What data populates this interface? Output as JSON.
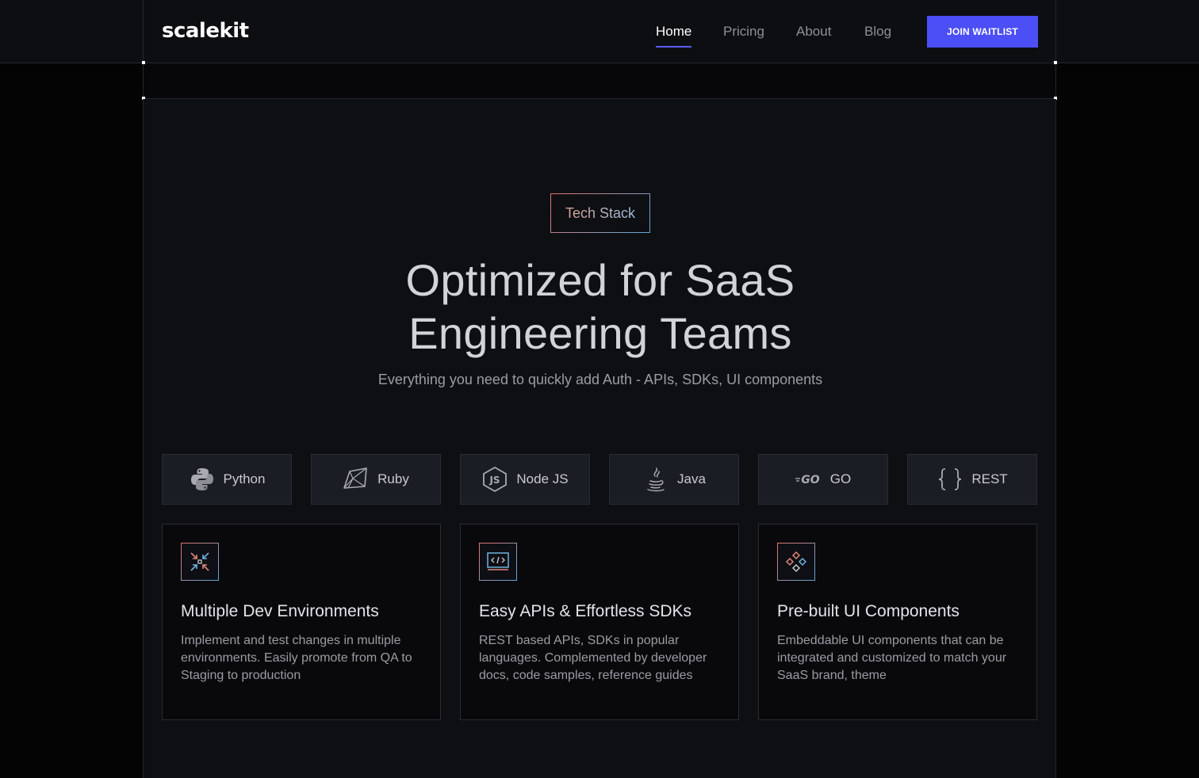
{
  "header": {
    "logo": "scalekit",
    "nav": [
      {
        "label": "Home",
        "active": true
      },
      {
        "label": "Pricing",
        "active": false
      },
      {
        "label": "About",
        "active": false
      },
      {
        "label": "Blog",
        "active": false
      }
    ],
    "cta_label": "JOIN WAITLIST"
  },
  "hero": {
    "badge": "Tech Stack",
    "title_line1": "Optimized for SaaS",
    "title_line2": "Engineering Teams",
    "subtitle": "Everything you need to quickly add Auth - APIs, SDKs, UI components"
  },
  "tech_stack": [
    {
      "label": "Python",
      "icon": "python-icon"
    },
    {
      "label": "Ruby",
      "icon": "ruby-icon"
    },
    {
      "label": "Node JS",
      "icon": "nodejs-icon"
    },
    {
      "label": "Java",
      "icon": "java-icon"
    },
    {
      "label": "GO",
      "icon": "go-icon",
      "icon_text": "GO"
    },
    {
      "label": "REST",
      "icon": "braces-icon"
    }
  ],
  "features": [
    {
      "icon": "compress-arrows-icon",
      "title": "Multiple Dev Environments",
      "description": "Implement and test changes in multiple environments. Easily promote from QA to Staging to production"
    },
    {
      "icon": "code-window-icon",
      "title": "Easy APIs & Effortless SDKs",
      "description": "REST based APIs, SDKs in popular languages. Complemented by developer docs, code samples, reference guides"
    },
    {
      "icon": "components-icon",
      "title": "Pre-built UI Components",
      "description": "Embeddable UI components that can be integrated and customized to match your SaaS brand, theme"
    }
  ],
  "colors": {
    "accent": "#4b4ff5",
    "gradient_start": "#e0726a",
    "gradient_end": "#5ea7d8",
    "page_bg": "#0e0f13"
  }
}
